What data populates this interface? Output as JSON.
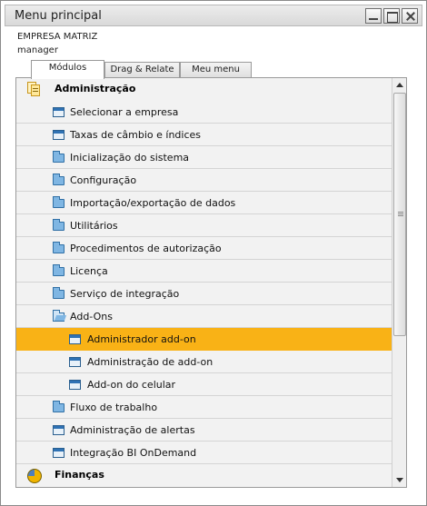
{
  "window": {
    "title": "Menu principal"
  },
  "session": {
    "company": "EMPRESA MATRIZ",
    "user": "manager"
  },
  "tabs": [
    {
      "label": "Módulos",
      "active": true
    },
    {
      "label": "Drag & Relate",
      "active": false
    },
    {
      "label": "Meu menu",
      "active": false
    }
  ],
  "modules": {
    "administracao": {
      "label": "Administração",
      "icon": "admin-documents-icon",
      "items": [
        {
          "label": "Selecionar a empresa",
          "icon": "window-icon"
        },
        {
          "label": "Taxas de câmbio e índices",
          "icon": "window-icon"
        },
        {
          "label": "Inicialização do sistema",
          "icon": "folder-icon"
        },
        {
          "label": "Configuração",
          "icon": "folder-icon"
        },
        {
          "label": "Importação/exportação de dados",
          "icon": "folder-icon"
        },
        {
          "label": "Utilitários",
          "icon": "folder-icon"
        },
        {
          "label": "Procedimentos de autorização",
          "icon": "folder-icon"
        },
        {
          "label": "Licença",
          "icon": "folder-icon"
        },
        {
          "label": "Serviço de integração",
          "icon": "folder-icon"
        },
        {
          "label": "Add-Ons",
          "icon": "folder-open-icon",
          "expanded": true,
          "children": [
            {
              "label": "Administrador add-on",
              "icon": "window-icon",
              "selected": true
            },
            {
              "label": "Administração de add-on",
              "icon": "window-icon"
            },
            {
              "label": "Add-on do celular",
              "icon": "window-icon"
            }
          ]
        },
        {
          "label": "Fluxo de trabalho",
          "icon": "folder-icon"
        },
        {
          "label": "Administração de alertas",
          "icon": "window-icon"
        },
        {
          "label": "Integração BI OnDemand",
          "icon": "window-icon"
        }
      ]
    },
    "financas": {
      "label": "Finanças",
      "icon": "finance-pie-icon"
    }
  },
  "colors": {
    "selected_row": "#f9b216",
    "panel_bg": "#f2f2f2"
  }
}
